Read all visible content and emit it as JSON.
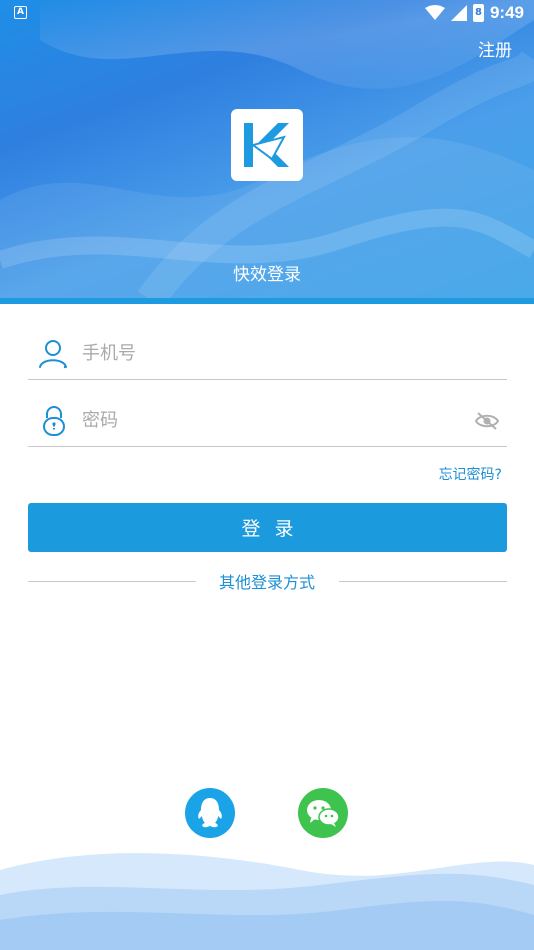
{
  "status_bar": {
    "notification_glyph": "A",
    "time": "9:49",
    "battery_glyph": "8"
  },
  "header": {
    "register_label": "注册",
    "app_title": "快效登录",
    "logo_letter": "K"
  },
  "form": {
    "phone_placeholder": "手机号",
    "phone_value": "",
    "password_placeholder": "密码",
    "password_value": "",
    "forgot_label": "忘记密码?",
    "login_label": "登录"
  },
  "other_login": {
    "label": "其他登录方式"
  },
  "icons": {
    "user": "user-icon",
    "lock": "lock-icon",
    "eye_off": "eye-off-icon",
    "qq": "qq-icon",
    "wechat": "wechat-icon"
  },
  "colors": {
    "primary": "#1b9ade",
    "link": "#1d8fd3",
    "qq": "#1aa3e6",
    "wechat": "#3ec34e"
  }
}
